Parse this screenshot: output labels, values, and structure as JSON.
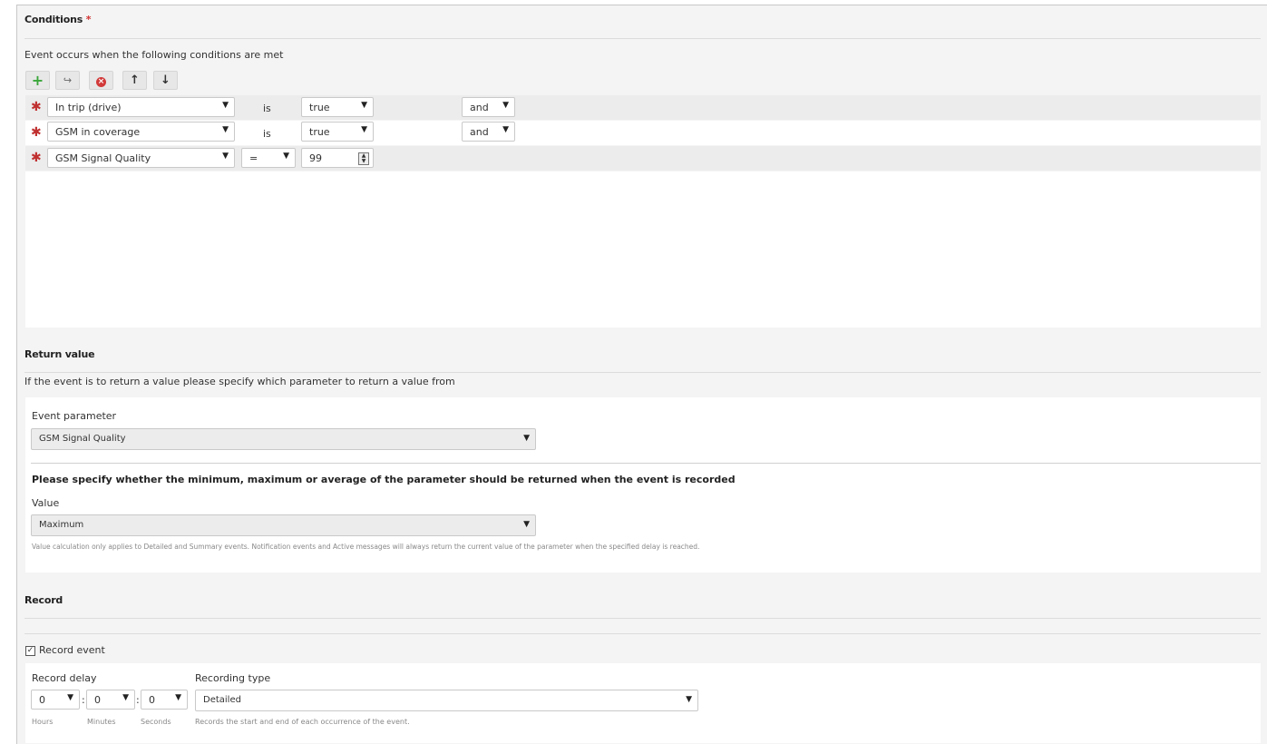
{
  "conditions": {
    "title": "Conditions",
    "required_mark": "*",
    "description": "Event occurs when the following conditions are met",
    "toolbar": {
      "add_icon": "plus-icon",
      "group_icon": "export-icon",
      "delete_icon": "remove-circle-icon",
      "up_icon": "arrow-up-icon",
      "down_icon": "arrow-down-icon"
    },
    "rows": [
      {
        "parameter": "In trip (drive)",
        "operator": "is",
        "value": "true",
        "joiner": "and"
      },
      {
        "parameter": "GSM in coverage",
        "operator": "is",
        "value": "true",
        "joiner": "and"
      },
      {
        "parameter": "GSM Signal Quality",
        "operator": "=",
        "value": "99"
      }
    ]
  },
  "return_value": {
    "title": "Return value",
    "description": "If the event is to return a value please specify which parameter to return a value from",
    "event_parameter_label": "Event parameter",
    "event_parameter_value": "GSM Signal Quality",
    "question": "Please specify whether the minimum, maximum or average of the parameter should be returned when the event is recorded",
    "value_label": "Value",
    "value_selected": "Maximum",
    "note": "Value calculation only applies to Detailed and Summary events. Notification events and Active messages will always return the current value of the parameter when the specified delay is reached."
  },
  "record": {
    "title": "Record",
    "record_event_label": "Record event",
    "record_event_checked": true,
    "record_delay_label": "Record delay",
    "hours": "0",
    "minutes": "0",
    "seconds": "0",
    "separator": ":",
    "hours_label": "Hours",
    "minutes_label": "Minutes",
    "seconds_label": "Seconds",
    "recording_type_label": "Recording type",
    "recording_type_value": "Detailed",
    "recording_type_note": "Records the start and end of each occurrence of the event."
  },
  "colors": {
    "add": "#3aa63a",
    "delete": "#d23a3a",
    "required": "#c03030"
  }
}
